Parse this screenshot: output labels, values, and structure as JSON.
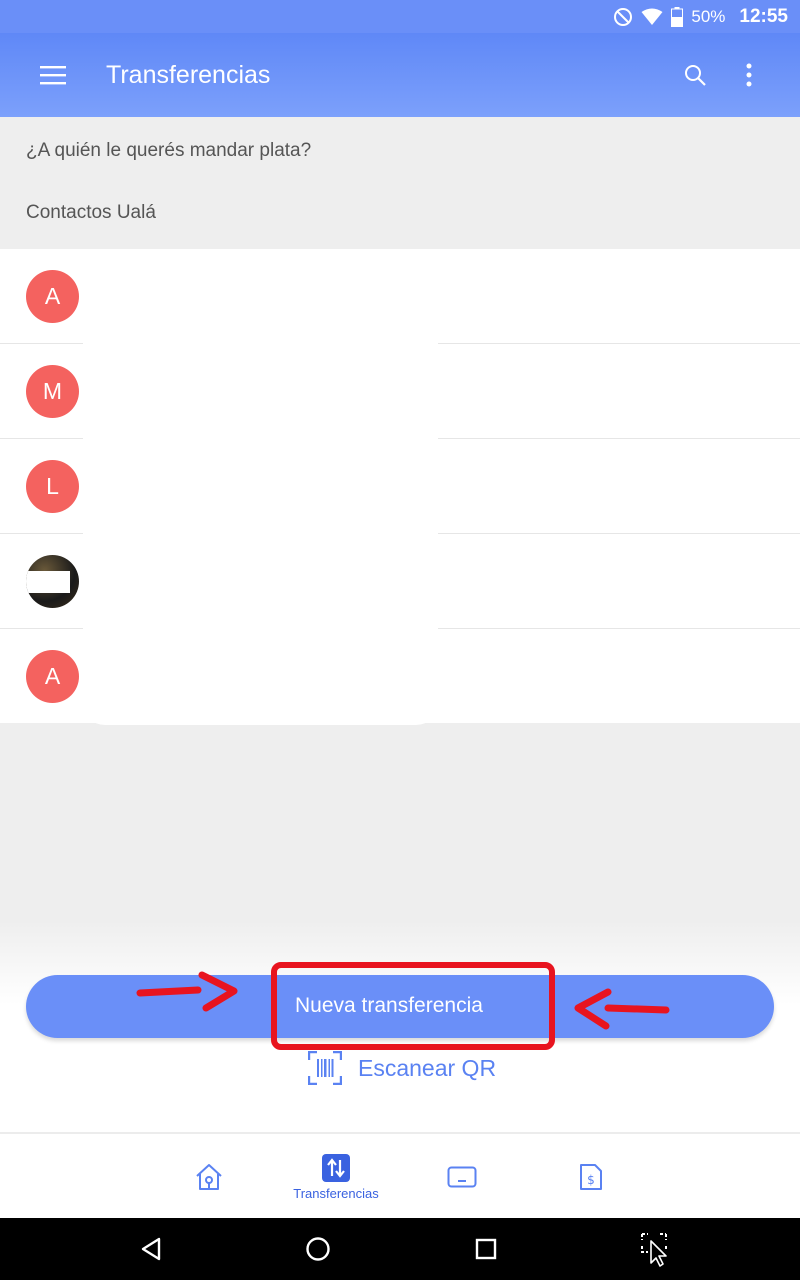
{
  "status_bar": {
    "battery": "50%",
    "time": "12:55"
  },
  "app_bar": {
    "title": "Transferencias"
  },
  "content": {
    "question": "¿A quién le querés mandar plata?",
    "section_title": "Contactos Ualá",
    "contacts": [
      {
        "initial": "A"
      },
      {
        "initial": "M"
      },
      {
        "initial": "L"
      },
      {
        "initial": ""
      },
      {
        "initial": "A"
      }
    ]
  },
  "actions": {
    "primary_button": "Nueva transferencia",
    "scan_qr": "Escanear QR"
  },
  "tab_bar": {
    "active_label": "Transferencias"
  },
  "colors": {
    "primary": "#6a8ff8",
    "avatar": "#f4625f",
    "highlight": "#e8141f"
  }
}
